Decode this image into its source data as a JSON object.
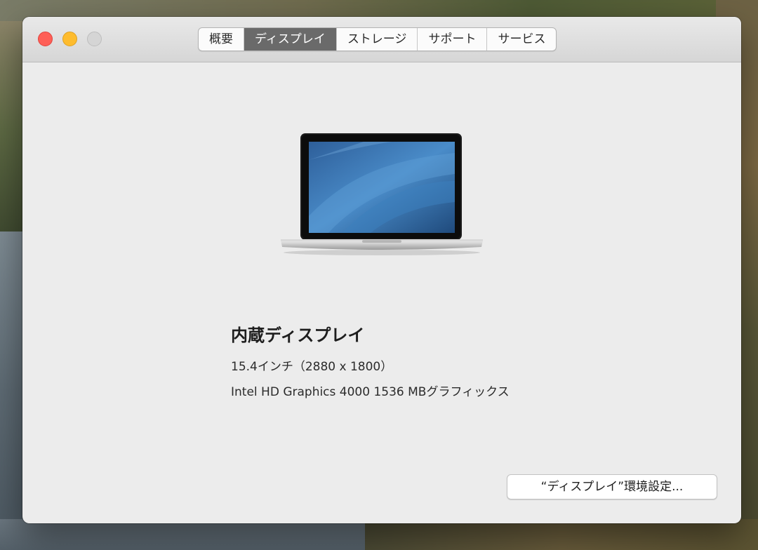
{
  "window": {
    "tabs": [
      {
        "label": "概要",
        "active": false
      },
      {
        "label": "ディスプレイ",
        "active": true
      },
      {
        "label": "ストレージ",
        "active": false
      },
      {
        "label": "サポート",
        "active": false
      },
      {
        "label": "サービス",
        "active": false
      }
    ]
  },
  "display": {
    "name": "内蔵ディスプレイ",
    "size_resolution": "15.4インチ（2880 x 1800）",
    "graphics": "Intel HD Graphics 4000 1536 MBグラフィックス"
  },
  "button": {
    "label": "“ディスプレイ”環境設定..."
  },
  "colors": {
    "active_tab": "#6a6a6a",
    "close": "#fe5f57",
    "minimize": "#febc2e",
    "zoom_disabled": "#d5d5d5",
    "window_bg": "#ececec"
  },
  "icons": {
    "laptop": "macbook-pro-icon"
  }
}
